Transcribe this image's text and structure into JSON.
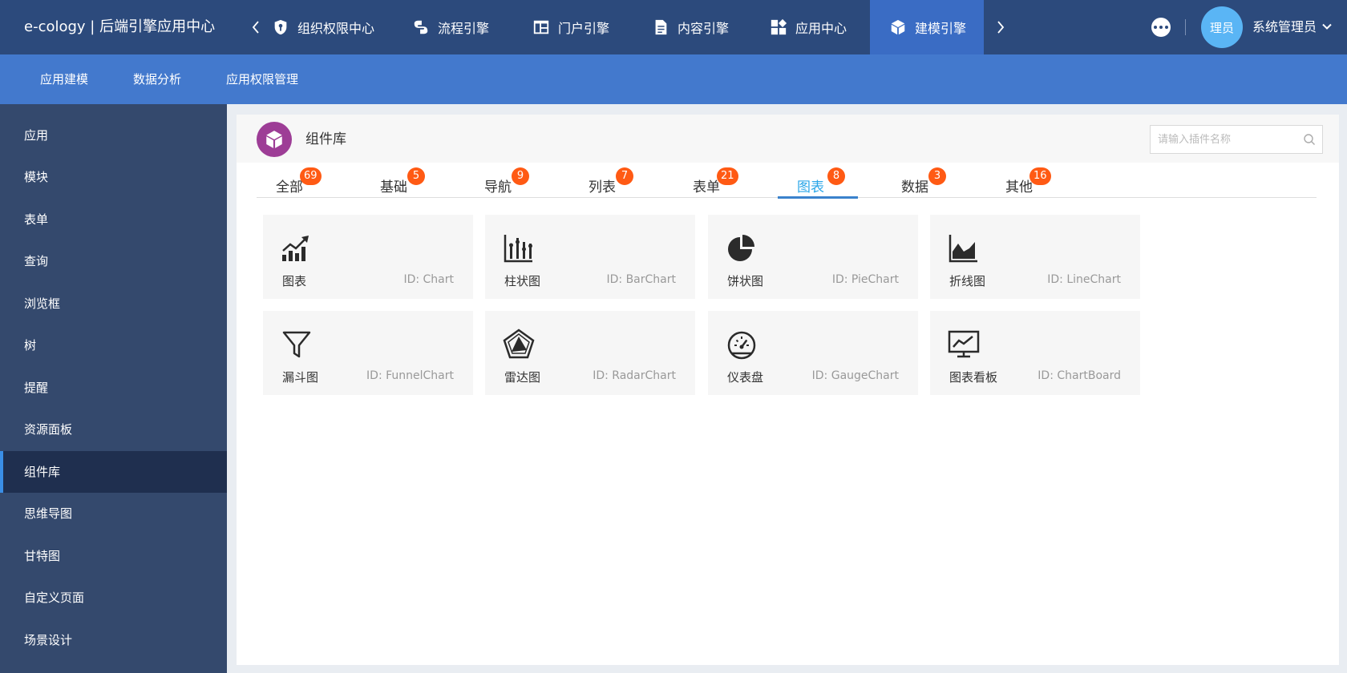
{
  "header": {
    "app_title": "e-cology | 后端引擎应用中心",
    "tabs": [
      {
        "label": "组织权限中心",
        "icon": "shield-key-icon"
      },
      {
        "label": "流程引擎",
        "icon": "flow-icon"
      },
      {
        "label": "门户引擎",
        "icon": "portal-icon"
      },
      {
        "label": "内容引擎",
        "icon": "document-icon"
      },
      {
        "label": "应用中心",
        "icon": "app-grid-icon"
      },
      {
        "label": "建模引擎",
        "icon": "cube-icon",
        "active": true
      }
    ],
    "avatar_text": "理员",
    "user_name": "系统管理员"
  },
  "subnav": {
    "items": [
      "应用建模",
      "数据分析",
      "应用权限管理"
    ]
  },
  "sidebar": {
    "items": [
      "应用",
      "模块",
      "表单",
      "查询",
      "浏览框",
      "树",
      "提醒",
      "资源面板",
      "组件库",
      "思维导图",
      "甘特图",
      "自定义页面",
      "场景设计"
    ],
    "active_index": 8
  },
  "panel": {
    "title": "组件库",
    "search_placeholder": "请输入插件名称",
    "tabs": [
      {
        "label": "全部",
        "count": "69"
      },
      {
        "label": "基础",
        "count": "5"
      },
      {
        "label": "导航",
        "count": "9"
      },
      {
        "label": "列表",
        "count": "7"
      },
      {
        "label": "表单",
        "count": "21"
      },
      {
        "label": "图表",
        "count": "8",
        "active": true
      },
      {
        "label": "数据",
        "count": "3"
      },
      {
        "label": "其他",
        "count": "16"
      }
    ],
    "cards": [
      {
        "name": "图表",
        "id": "ID: Chart",
        "icon": "chart-trend-icon"
      },
      {
        "name": "柱状图",
        "id": "ID: BarChart",
        "icon": "bar-chart-icon"
      },
      {
        "name": "饼状图",
        "id": "ID: PieChart",
        "icon": "pie-chart-icon"
      },
      {
        "name": "折线图",
        "id": "ID: LineChart",
        "icon": "area-chart-icon"
      },
      {
        "name": "漏斗图",
        "id": "ID: FunnelChart",
        "icon": "funnel-icon"
      },
      {
        "name": "雷达图",
        "id": "ID: RadarChart",
        "icon": "radar-chart-icon"
      },
      {
        "name": "仪表盘",
        "id": "ID: GaugeChart",
        "icon": "gauge-icon"
      },
      {
        "name": "图表看板",
        "id": "ID: ChartBoard",
        "icon": "chart-board-icon"
      }
    ]
  },
  "colors": {
    "topbar": "#2c4a7c",
    "subnav": "#4379cd",
    "sidebar": "#34496d",
    "active_tab_text": "#2aa6e8",
    "badge": "#ff5a14",
    "panel_logo": "#9d3d96"
  }
}
